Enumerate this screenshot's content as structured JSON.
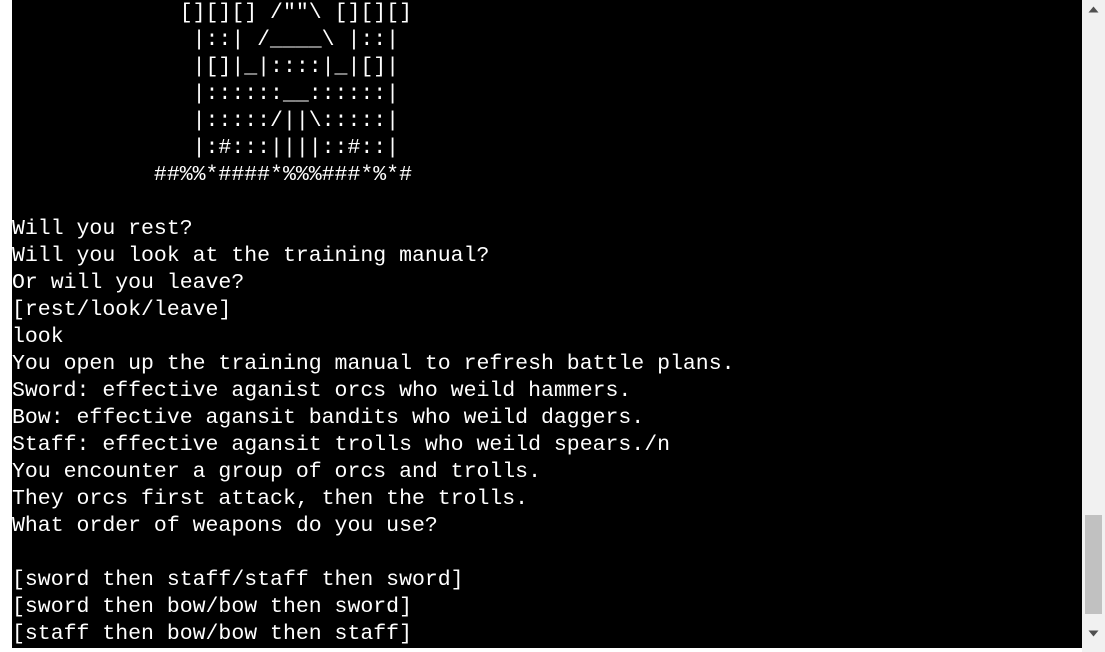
{
  "terminal": {
    "lines": [
      "             [][][] /\"\"\\ [][][]",
      "              |::| /____\\ |::|",
      "              |[]|_|::::|_|[]|",
      "              |::::::__::::::|",
      "              |:::::/||\\:::::|",
      "              |:#:::||||::#::|",
      "           ##%%*####*%%%###*%*#",
      "",
      "Will you rest?",
      "Will you look at the training manual?",
      "Or will you leave?",
      "[rest/look/leave]",
      "look",
      "You open up the training manual to refresh battle plans.",
      "Sword: effective aganist orcs who weild hammers.",
      "Bow: effective agansit bandits who weild daggers.",
      "Staff: effective agansit trolls who weild spears./n",
      "You encounter a group of orcs and trolls.",
      "They orcs first attack, then the trolls.",
      "What order of weapons do you use?",
      "",
      "[sword then staff/staff then sword]",
      "[sword then bow/bow then sword]",
      "[staff then bow/bow then staff]"
    ]
  },
  "scrollbar": {
    "up_icon": "triangle-up-icon",
    "down_icon": "triangle-down-icon",
    "colors": {
      "track": "#f1f1f1",
      "thumb": "#c1c1c1",
      "arrow": "#505050"
    }
  },
  "colors": {
    "terminal_background": "#000000",
    "terminal_text": "#ffffff"
  }
}
